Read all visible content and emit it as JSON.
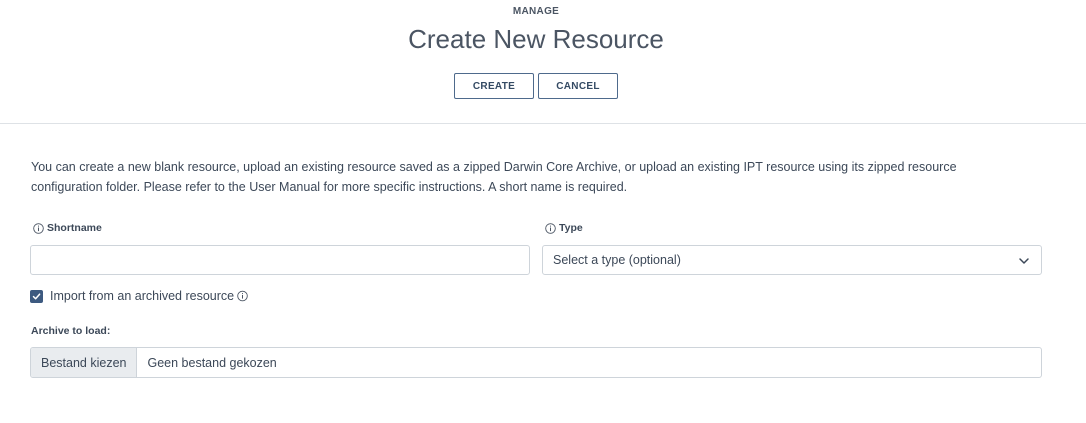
{
  "header": {
    "eyebrow": "MANAGE",
    "title": "Create New Resource",
    "create_label": "CREATE",
    "cancel_label": "CANCEL"
  },
  "intro": "You can create a new blank resource, upload an existing resource saved as a zipped Darwin Core Archive, or upload an existing IPT resource using its zipped resource configuration folder. Please refer to the User Manual for more specific instructions. A short name is required.",
  "form": {
    "shortname_label": "Shortname",
    "shortname_value": "",
    "type_label": "Type",
    "type_selected": "Select a type (optional)",
    "import_checkbox_label": "Import from an archived resource",
    "import_checked": true,
    "archive_label": "Archive to load:",
    "file_button_label": "Bestand kiezen",
    "file_status": "Geen bestand gekozen"
  },
  "colors": {
    "accent": "#3d5a80",
    "button_border": "#4e6a8c"
  },
  "icons": {
    "info": "info-circle-icon",
    "chevron": "chevron-down-icon",
    "check": "checkmark-icon"
  }
}
